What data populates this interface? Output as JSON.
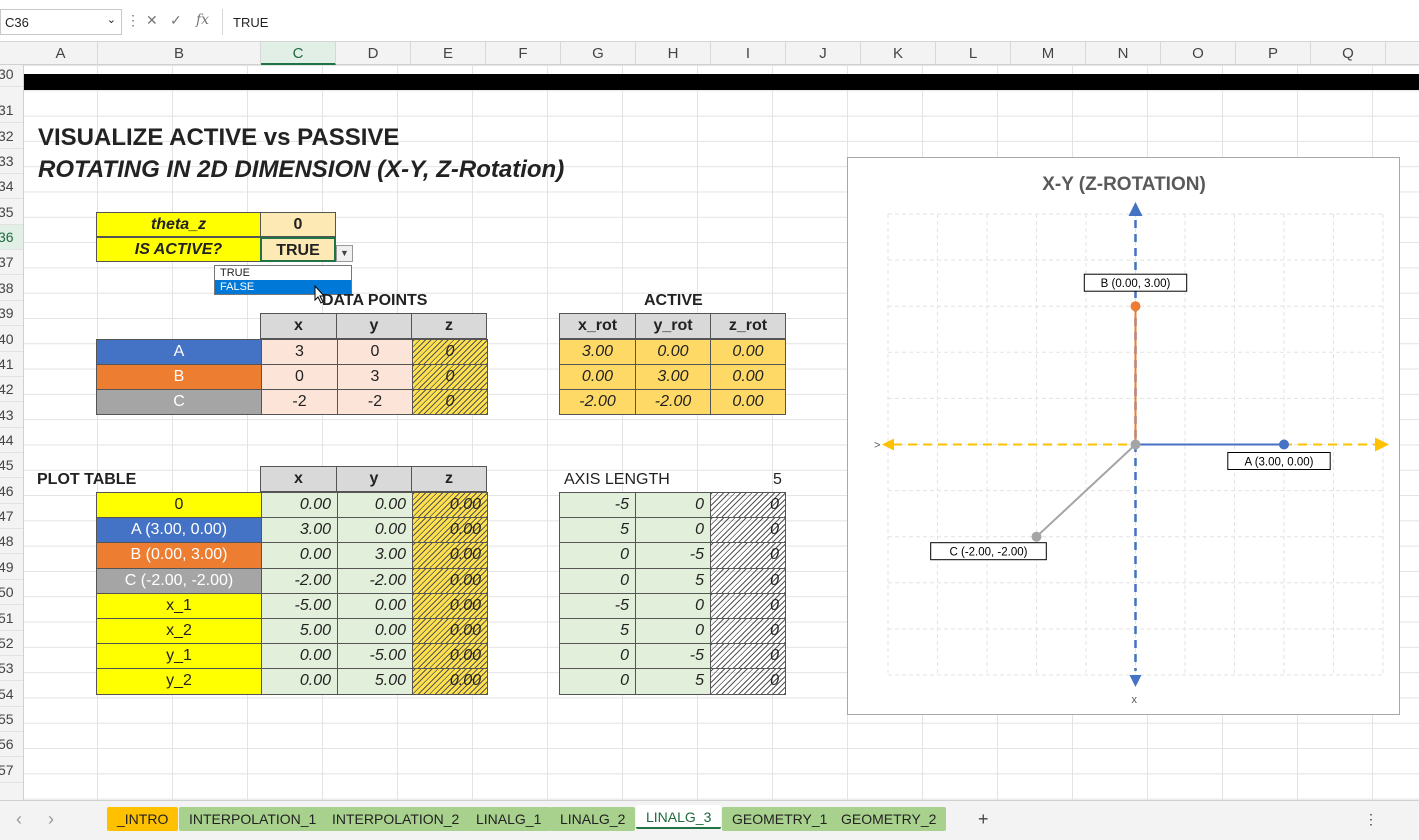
{
  "namebox": "C36",
  "formula": "TRUE",
  "columns": [
    "A",
    "B",
    "C",
    "D",
    "E",
    "F",
    "G",
    "H",
    "I",
    "J",
    "K",
    "L",
    "M",
    "N",
    "O",
    "P",
    "Q"
  ],
  "rows": [
    "30",
    "31",
    "32",
    "33",
    "34",
    "35",
    "36",
    "37",
    "38",
    "39",
    "40",
    "41",
    "42",
    "43",
    "44",
    "45",
    "46",
    "47",
    "48",
    "49",
    "50",
    "51",
    "52",
    "53",
    "54",
    "55",
    "56",
    "57"
  ],
  "title1": "VISUALIZE ACTIVE vs PASSIVE",
  "title2": "ROTATING IN 2D DIMENSION (X-Y, Z-Rotation)",
  "params": {
    "theta_label": "theta_z",
    "theta_val": "0",
    "active_label": "IS ACTIVE?",
    "active_val": "TRUE"
  },
  "dropdown": {
    "options": [
      "TRUE",
      "FALSE"
    ],
    "highlighted": "FALSE"
  },
  "datapoints": {
    "title": "DATA POINTS",
    "headers": [
      "x",
      "y",
      "z"
    ],
    "rows": [
      {
        "name": "A",
        "x": "3",
        "y": "0",
        "z": "0"
      },
      {
        "name": "B",
        "x": "0",
        "y": "3",
        "z": "0"
      },
      {
        "name": "C",
        "x": "-2",
        "y": "-2",
        "z": "0"
      }
    ]
  },
  "active": {
    "title": "ACTIVE",
    "headers": [
      "x_rot",
      "y_rot",
      "z_rot"
    ],
    "rows": [
      [
        "3.00",
        "0.00",
        "0.00"
      ],
      [
        "0.00",
        "3.00",
        "0.00"
      ],
      [
        "-2.00",
        "-2.00",
        "0.00"
      ]
    ]
  },
  "plottable": {
    "title": "PLOT TABLE",
    "headers": [
      "x",
      "y",
      "z"
    ],
    "rows": [
      {
        "name": "0",
        "x": "0.00",
        "y": "0.00",
        "z": "0.00"
      },
      {
        "name": "A (3.00, 0.00)",
        "x": "3.00",
        "y": "0.00",
        "z": "0.00"
      },
      {
        "name": "B (0.00, 3.00)",
        "x": "0.00",
        "y": "3.00",
        "z": "0.00"
      },
      {
        "name": "C (-2.00, -2.00)",
        "x": "-2.00",
        "y": "-2.00",
        "z": "0.00"
      },
      {
        "name": "x_1",
        "x": "-5.00",
        "y": "0.00",
        "z": "0.00"
      },
      {
        "name": "x_2",
        "x": "5.00",
        "y": "0.00",
        "z": "0.00"
      },
      {
        "name": "y_1",
        "x": "0.00",
        "y": "-5.00",
        "z": "0.00"
      },
      {
        "name": "y_2",
        "x": "0.00",
        "y": "5.00",
        "z": "0.00"
      }
    ]
  },
  "axislength": {
    "label": "AXIS LENGTH",
    "value": "5",
    "rows": [
      [
        "-5",
        "0",
        "0"
      ],
      [
        "5",
        "0",
        "0"
      ],
      [
        "0",
        "-5",
        "0"
      ],
      [
        "0",
        "5",
        "0"
      ],
      [
        "-5",
        "0",
        "0"
      ],
      [
        "5",
        "0",
        "0"
      ],
      [
        "0",
        "-5",
        "0"
      ],
      [
        "0",
        "5",
        "0"
      ]
    ]
  },
  "tabs": [
    "_INTRO",
    "INTERPOLATION_1",
    "INTERPOLATION_2",
    "LINALG_1",
    "LINALG_2",
    "LINALG_3",
    "GEOMETRY_1",
    "GEOMETRY_2"
  ],
  "active_tab": "LINALG_3",
  "add_sheet": "+",
  "chart_data": {
    "type": "scatter",
    "title": "X-Y (Z-ROTATION)",
    "xlim": [
      -5,
      5
    ],
    "ylim": [
      -5,
      5
    ],
    "points": [
      {
        "label": "A (3.00, 0.00)",
        "x": 3,
        "y": 0,
        "color": "#4472c4"
      },
      {
        "label": "B (0.00, 3.00)",
        "x": 0,
        "y": 3,
        "color": "#ed7d31"
      },
      {
        "label": "C (-2.00, -2.00)",
        "x": -2,
        "y": -2,
        "color": "#a5a5a5"
      }
    ],
    "axis_labels": {
      "x_left": ">",
      "y_bottom": "x"
    }
  }
}
